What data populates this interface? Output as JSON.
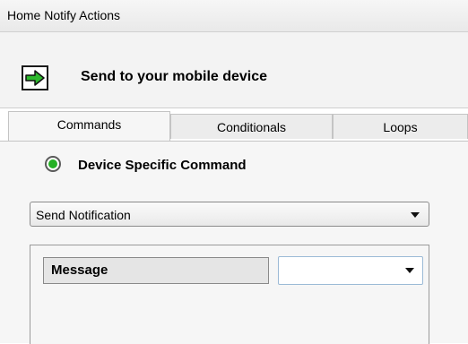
{
  "window": {
    "title": "Home Notify Actions"
  },
  "header": {
    "heading": "Send  to your mobile device",
    "icon": "green-arrow-right-icon",
    "accent": "#2db82d"
  },
  "tabs": [
    {
      "label": "Commands",
      "active": true
    },
    {
      "label": "Conditionals",
      "active": false
    },
    {
      "label": "Loops",
      "active": false
    }
  ],
  "command": {
    "radio_label": "Device Specific Command",
    "radio_selected": true,
    "select_value": "Send Notification"
  },
  "parameters": {
    "message_label": "Message",
    "message_value": ""
  }
}
